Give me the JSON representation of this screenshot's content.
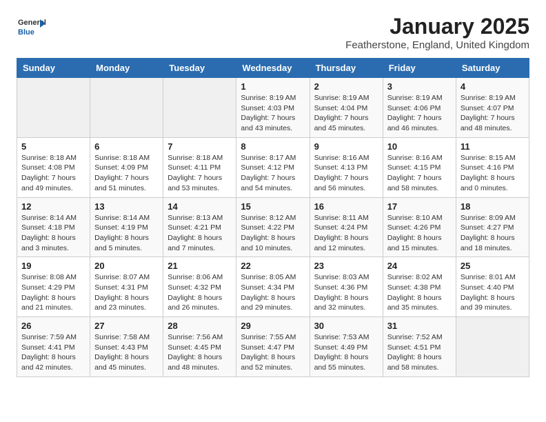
{
  "logo": {
    "general": "General",
    "blue": "Blue"
  },
  "title": "January 2025",
  "subtitle": "Featherstone, England, United Kingdom",
  "weekdays": [
    "Sunday",
    "Monday",
    "Tuesday",
    "Wednesday",
    "Thursday",
    "Friday",
    "Saturday"
  ],
  "weeks": [
    [
      {
        "day": "",
        "info": ""
      },
      {
        "day": "",
        "info": ""
      },
      {
        "day": "",
        "info": ""
      },
      {
        "day": "1",
        "info": "Sunrise: 8:19 AM\nSunset: 4:03 PM\nDaylight: 7 hours and 43 minutes."
      },
      {
        "day": "2",
        "info": "Sunrise: 8:19 AM\nSunset: 4:04 PM\nDaylight: 7 hours and 45 minutes."
      },
      {
        "day": "3",
        "info": "Sunrise: 8:19 AM\nSunset: 4:06 PM\nDaylight: 7 hours and 46 minutes."
      },
      {
        "day": "4",
        "info": "Sunrise: 8:19 AM\nSunset: 4:07 PM\nDaylight: 7 hours and 48 minutes."
      }
    ],
    [
      {
        "day": "5",
        "info": "Sunrise: 8:18 AM\nSunset: 4:08 PM\nDaylight: 7 hours and 49 minutes."
      },
      {
        "day": "6",
        "info": "Sunrise: 8:18 AM\nSunset: 4:09 PM\nDaylight: 7 hours and 51 minutes."
      },
      {
        "day": "7",
        "info": "Sunrise: 8:18 AM\nSunset: 4:11 PM\nDaylight: 7 hours and 53 minutes."
      },
      {
        "day": "8",
        "info": "Sunrise: 8:17 AM\nSunset: 4:12 PM\nDaylight: 7 hours and 54 minutes."
      },
      {
        "day": "9",
        "info": "Sunrise: 8:16 AM\nSunset: 4:13 PM\nDaylight: 7 hours and 56 minutes."
      },
      {
        "day": "10",
        "info": "Sunrise: 8:16 AM\nSunset: 4:15 PM\nDaylight: 7 hours and 58 minutes."
      },
      {
        "day": "11",
        "info": "Sunrise: 8:15 AM\nSunset: 4:16 PM\nDaylight: 8 hours and 0 minutes."
      }
    ],
    [
      {
        "day": "12",
        "info": "Sunrise: 8:14 AM\nSunset: 4:18 PM\nDaylight: 8 hours and 3 minutes."
      },
      {
        "day": "13",
        "info": "Sunrise: 8:14 AM\nSunset: 4:19 PM\nDaylight: 8 hours and 5 minutes."
      },
      {
        "day": "14",
        "info": "Sunrise: 8:13 AM\nSunset: 4:21 PM\nDaylight: 8 hours and 7 minutes."
      },
      {
        "day": "15",
        "info": "Sunrise: 8:12 AM\nSunset: 4:22 PM\nDaylight: 8 hours and 10 minutes."
      },
      {
        "day": "16",
        "info": "Sunrise: 8:11 AM\nSunset: 4:24 PM\nDaylight: 8 hours and 12 minutes."
      },
      {
        "day": "17",
        "info": "Sunrise: 8:10 AM\nSunset: 4:26 PM\nDaylight: 8 hours and 15 minutes."
      },
      {
        "day": "18",
        "info": "Sunrise: 8:09 AM\nSunset: 4:27 PM\nDaylight: 8 hours and 18 minutes."
      }
    ],
    [
      {
        "day": "19",
        "info": "Sunrise: 8:08 AM\nSunset: 4:29 PM\nDaylight: 8 hours and 21 minutes."
      },
      {
        "day": "20",
        "info": "Sunrise: 8:07 AM\nSunset: 4:31 PM\nDaylight: 8 hours and 23 minutes."
      },
      {
        "day": "21",
        "info": "Sunrise: 8:06 AM\nSunset: 4:32 PM\nDaylight: 8 hours and 26 minutes."
      },
      {
        "day": "22",
        "info": "Sunrise: 8:05 AM\nSunset: 4:34 PM\nDaylight: 8 hours and 29 minutes."
      },
      {
        "day": "23",
        "info": "Sunrise: 8:03 AM\nSunset: 4:36 PM\nDaylight: 8 hours and 32 minutes."
      },
      {
        "day": "24",
        "info": "Sunrise: 8:02 AM\nSunset: 4:38 PM\nDaylight: 8 hours and 35 minutes."
      },
      {
        "day": "25",
        "info": "Sunrise: 8:01 AM\nSunset: 4:40 PM\nDaylight: 8 hours and 39 minutes."
      }
    ],
    [
      {
        "day": "26",
        "info": "Sunrise: 7:59 AM\nSunset: 4:41 PM\nDaylight: 8 hours and 42 minutes."
      },
      {
        "day": "27",
        "info": "Sunrise: 7:58 AM\nSunset: 4:43 PM\nDaylight: 8 hours and 45 minutes."
      },
      {
        "day": "28",
        "info": "Sunrise: 7:56 AM\nSunset: 4:45 PM\nDaylight: 8 hours and 48 minutes."
      },
      {
        "day": "29",
        "info": "Sunrise: 7:55 AM\nSunset: 4:47 PM\nDaylight: 8 hours and 52 minutes."
      },
      {
        "day": "30",
        "info": "Sunrise: 7:53 AM\nSunset: 4:49 PM\nDaylight: 8 hours and 55 minutes."
      },
      {
        "day": "31",
        "info": "Sunrise: 7:52 AM\nSunset: 4:51 PM\nDaylight: 8 hours and 58 minutes."
      },
      {
        "day": "",
        "info": ""
      }
    ]
  ]
}
